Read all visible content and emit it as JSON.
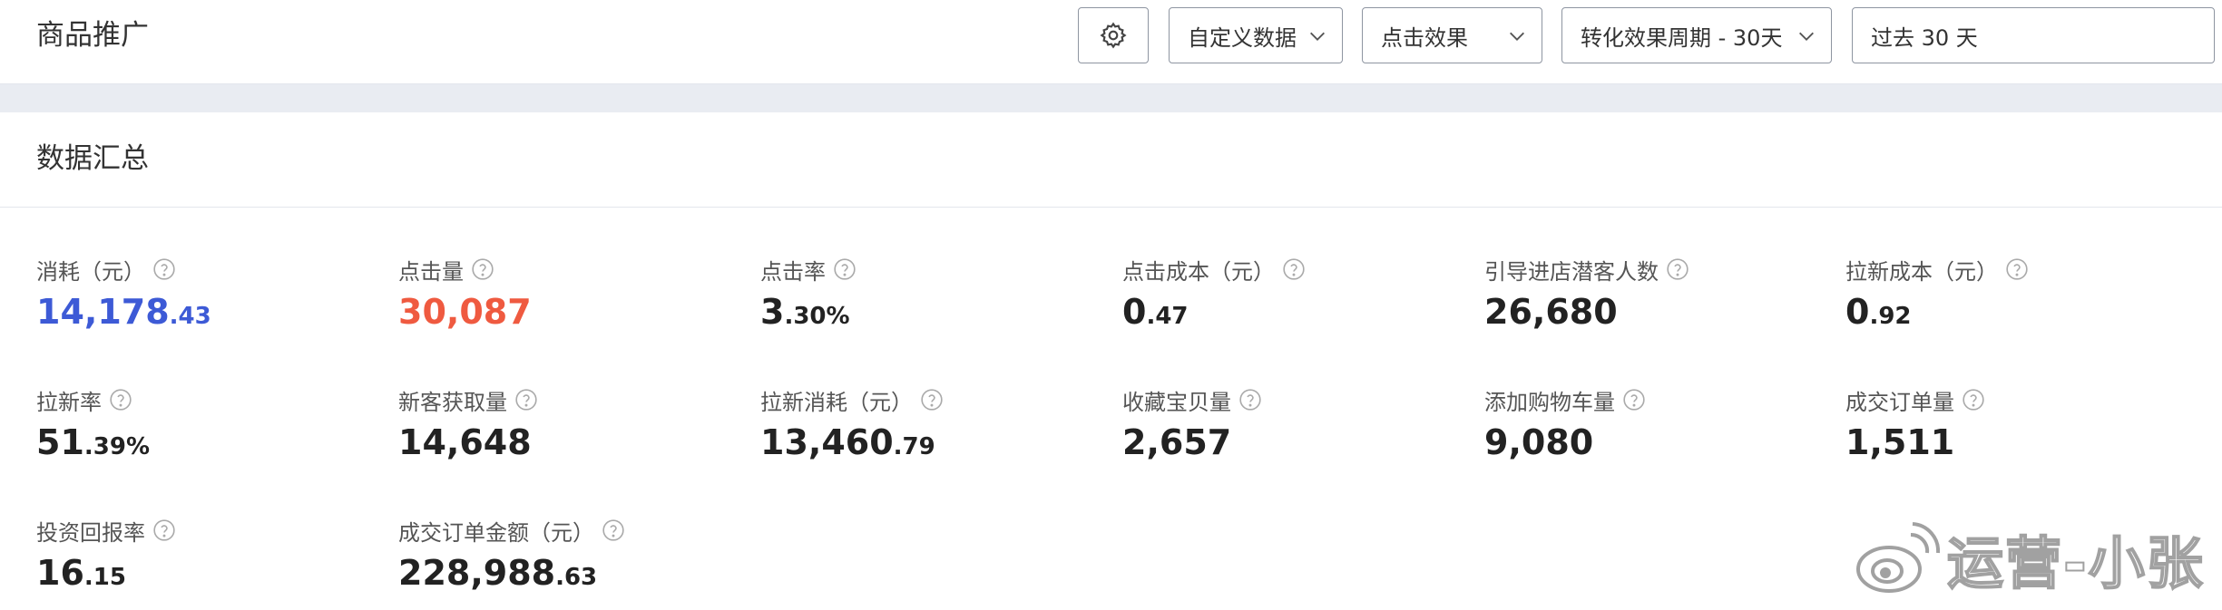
{
  "header": {
    "title": "商品推广",
    "controls": {
      "custom_data": "自定义数据",
      "click_effect": "点击效果",
      "conversion_period": "转化效果周期 - 30天",
      "date_range": "过去 30 天"
    }
  },
  "summary": {
    "title": "数据汇总",
    "metrics": [
      {
        "label": "消耗（元）",
        "int": "14,178",
        "dec": ".43",
        "unit": "",
        "color": "#3d5ad6"
      },
      {
        "label": "点击量",
        "int": "30,087",
        "dec": "",
        "unit": "",
        "color": "#ef5a40"
      },
      {
        "label": "点击率",
        "int": "3",
        "dec": ".30",
        "unit": "%"
      },
      {
        "label": "点击成本（元）",
        "int": "0",
        "dec": ".47",
        "unit": ""
      },
      {
        "label": "引导进店潜客人数",
        "int": "26,680",
        "dec": "",
        "unit": ""
      },
      {
        "label": "拉新成本（元）",
        "int": "0",
        "dec": ".92",
        "unit": ""
      },
      {
        "label": "拉新率",
        "int": "51",
        "dec": ".39",
        "unit": "%"
      },
      {
        "label": "新客获取量",
        "int": "14,648",
        "dec": "",
        "unit": ""
      },
      {
        "label": "拉新消耗（元）",
        "int": "13,460",
        "dec": ".79",
        "unit": ""
      },
      {
        "label": "收藏宝贝量",
        "int": "2,657",
        "dec": "",
        "unit": ""
      },
      {
        "label": "添加购物车量",
        "int": "9,080",
        "dec": "",
        "unit": ""
      },
      {
        "label": "成交订单量",
        "int": "1,511",
        "dec": "",
        "unit": ""
      },
      {
        "label": "投资回报率",
        "int": "16",
        "dec": ".15",
        "unit": ""
      },
      {
        "label": "成交订单金额（元）",
        "int": "228,988",
        "dec": ".63",
        "unit": ""
      }
    ]
  },
  "watermark": {
    "text": "运营-小张",
    "icon": "weibo-icon"
  },
  "colors": {
    "accent_blue": "#3d5ad6",
    "accent_red": "#ef5a40",
    "band": "#e9ecf2"
  }
}
